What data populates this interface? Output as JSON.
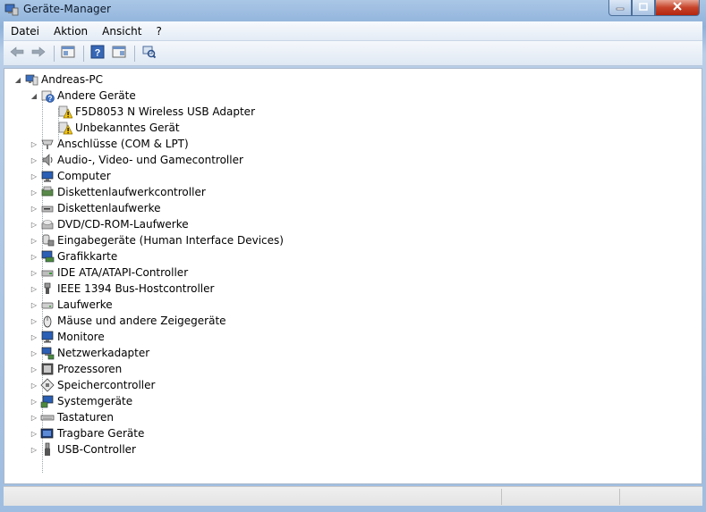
{
  "window": {
    "title": "Geräte-Manager"
  },
  "menu": [
    {
      "label": "Datei"
    },
    {
      "label": "Aktion"
    },
    {
      "label": "Ansicht"
    },
    {
      "label": "?"
    }
  ],
  "toolbar": {
    "icons": [
      "back-icon",
      "forward-icon",
      "properties-view-icon",
      "help-icon",
      "show-hidden-icon",
      "scan-hardware-icon"
    ]
  },
  "tree": {
    "root": {
      "label": "Andreas-PC",
      "expanded": true
    },
    "andere": {
      "label": "Andere Geräte",
      "expanded": true,
      "children": [
        {
          "label": "F5D8053 N Wireless USB Adapter"
        },
        {
          "label": "Unbekanntes Gerät"
        }
      ]
    },
    "categories": [
      {
        "label": "Anschlüsse (COM & LPT)",
        "icon": "port-icon"
      },
      {
        "label": "Audio-, Video- und Gamecontroller",
        "icon": "speaker-icon"
      },
      {
        "label": "Computer",
        "icon": "computer-icon"
      },
      {
        "label": "Diskettenlaufwerkcontroller",
        "icon": "floppy-controller-icon"
      },
      {
        "label": "Diskettenlaufwerke",
        "icon": "floppy-drive-icon"
      },
      {
        "label": "DVD/CD-ROM-Laufwerke",
        "icon": "dvd-drive-icon"
      },
      {
        "label": "Eingabegeräte (Human Interface Devices)",
        "icon": "hid-icon"
      },
      {
        "label": "Grafikkarte",
        "icon": "display-adapter-icon"
      },
      {
        "label": "IDE ATA/ATAPI-Controller",
        "icon": "ide-controller-icon"
      },
      {
        "label": "IEEE 1394 Bus-Hostcontroller",
        "icon": "firewire-icon"
      },
      {
        "label": "Laufwerke",
        "icon": "disk-drive-icon"
      },
      {
        "label": "Mäuse und andere Zeigegeräte",
        "icon": "mouse-icon"
      },
      {
        "label": "Monitore",
        "icon": "monitor-icon"
      },
      {
        "label": "Netzwerkadapter",
        "icon": "network-adapter-icon"
      },
      {
        "label": "Prozessoren",
        "icon": "processor-icon"
      },
      {
        "label": "Speichercontroller",
        "icon": "storage-controller-icon"
      },
      {
        "label": "Systemgeräte",
        "icon": "system-devices-icon"
      },
      {
        "label": "Tastaturen",
        "icon": "keyboard-icon"
      },
      {
        "label": "Tragbare Geräte",
        "icon": "portable-devices-icon"
      },
      {
        "label": "USB-Controller",
        "icon": "usb-icon"
      }
    ]
  },
  "colors": {
    "warning": "#f2c40e",
    "frame": "#9fbde0",
    "monitor_blue": "#2a5fb5"
  }
}
